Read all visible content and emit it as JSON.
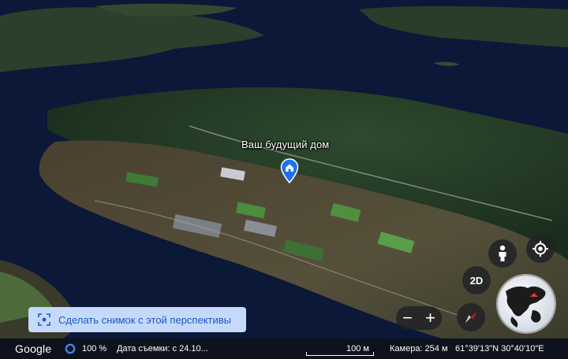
{
  "place": {
    "label": "Ваш будущий дом",
    "pin_icon": "home-pin-icon"
  },
  "snapshot": {
    "label": "Сделать снимок с этой перспективы",
    "icon": "screenshot-icon"
  },
  "controls": {
    "view_mode": "2D",
    "zoom_out": "−",
    "zoom_in": "+",
    "icons": [
      "pegman-icon",
      "locate-icon",
      "compass-icon",
      "globe-icon"
    ]
  },
  "status": {
    "logo": "Google",
    "loading_pct": "100 %",
    "capture_date": "Дата съемки: с 24.10...",
    "scale": "100 м",
    "camera": "Камера: 254 м",
    "coords": "61°39'13\"N 30°40'10\"E"
  },
  "colors": {
    "water": "#0c1838",
    "forest": "#25402a",
    "accent_pin": "#1a73e8",
    "button_bg": "#c5dafb"
  }
}
